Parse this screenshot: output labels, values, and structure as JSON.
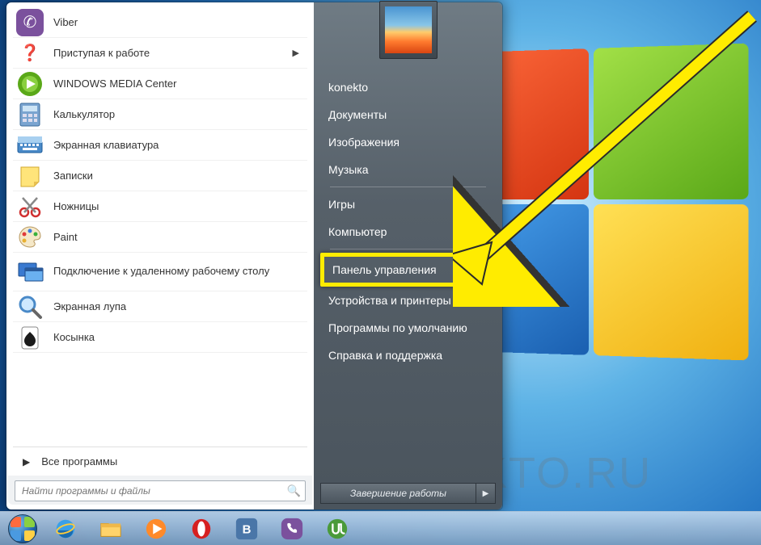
{
  "watermark": "KONEKTO.RU",
  "start_menu": {
    "apps": [
      {
        "label": "Viber",
        "icon": "viber",
        "arrow": false
      },
      {
        "label": "Приступая к работе",
        "icon": "getting-started",
        "arrow": true
      },
      {
        "label": "WINDOWS MEDIA Center",
        "icon": "media-center",
        "arrow": false
      },
      {
        "label": "Калькулятор",
        "icon": "calculator",
        "arrow": false
      },
      {
        "label": "Экранная клавиатура",
        "icon": "keyboard",
        "arrow": false
      },
      {
        "label": "Записки",
        "icon": "sticky-notes",
        "arrow": false
      },
      {
        "label": "Ножницы",
        "icon": "snipping",
        "arrow": false
      },
      {
        "label": "Paint",
        "icon": "paint",
        "arrow": false
      },
      {
        "label": "Подключение к удаленному рабочему столу",
        "icon": "remote",
        "arrow": false,
        "tall": true
      },
      {
        "label": "Экранная лупа",
        "icon": "magnifier",
        "arrow": false
      },
      {
        "label": "Косынка",
        "icon": "solitaire",
        "arrow": false
      }
    ],
    "all_programs": "Все программы",
    "search_placeholder": "Найти программы и файлы",
    "right": {
      "username": "konekto",
      "groups": [
        [
          "Документы",
          "Изображения",
          "Музыка"
        ],
        [
          "Игры",
          "Компьютер"
        ],
        [
          "Панель управления",
          "Устройства и принтеры",
          "Программы по умолчанию",
          "Справка и поддержка"
        ]
      ],
      "highlighted_index": [
        2,
        0
      ]
    },
    "shutdown_label": "Завершение работы"
  },
  "taskbar": {
    "items": [
      {
        "name": "internet-explorer",
        "icon": "ie"
      },
      {
        "name": "file-explorer",
        "icon": "explorer"
      },
      {
        "name": "media-player",
        "icon": "wmp"
      },
      {
        "name": "opera",
        "icon": "opera"
      },
      {
        "name": "vk",
        "icon": "vk"
      },
      {
        "name": "viber",
        "icon": "viber-tb"
      },
      {
        "name": "utorrent",
        "icon": "utorrent"
      }
    ]
  }
}
